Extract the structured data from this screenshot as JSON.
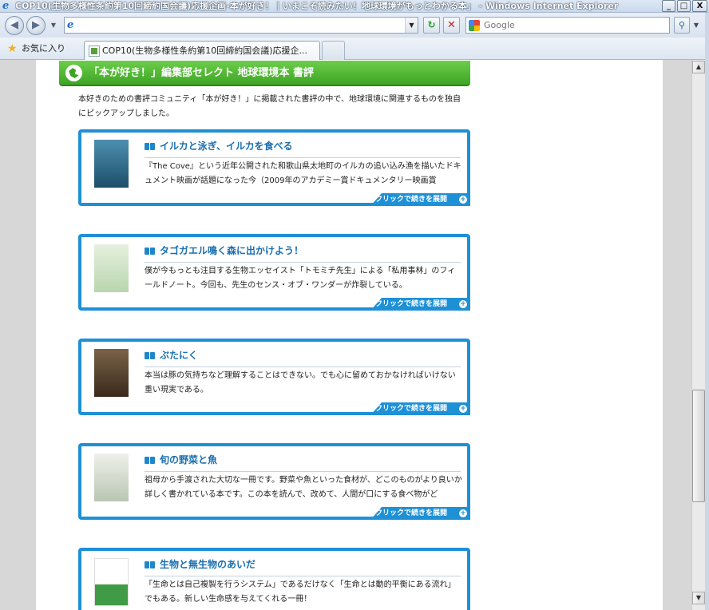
{
  "window": {
    "title": "COP10(生物多様性条約第10回締約国会議)応援企画-本が好き！｜いまこそ読みたい！地球環境がもっとわかる本」 - Windows Internet Explorer",
    "minimize": "_",
    "maximize": "□",
    "close": "X"
  },
  "navbar": {
    "address_value": "",
    "search_placeholder": "Google"
  },
  "favorites": {
    "label": "お気に入り",
    "tab_label": "COP10(生物多様性条約第10回締約国会議)応援企..."
  },
  "page": {
    "section_title": "「本が好き！」編集部セレクト 地球環境本 書評",
    "intro": "本好きのための書評コミュニティ「本が好き！」に掲載された書評の中で、地球環境に関連するものを独自にピックアップしました。",
    "expand_label": "クリックで続きを展開",
    "cards": [
      {
        "title": "イルカと泳ぎ、イルカを食べる",
        "text": "『The Cove』という近年公開された和歌山県太地町のイルカの追い込み漁を描いたドキュメント映画が話題になった今（2009年のアカデミー賞ドキュメンタリー映画賞",
        "thumb_color": "#2d6e8e"
      },
      {
        "title": "タゴガエル鳴く森に出かけよう！",
        "text": "僕が今もっとも注目する生物エッセイスト「トモミチ先生」による「私用事林」のフィールドノート。今回も、先生のセンス・オブ・ワンダーが炸裂している。",
        "thumb_color": "#cfe3c6"
      },
      {
        "title": "ぶたにく",
        "text": "本当は豚の気持ちなど理解することはできない。でも心に留めておかなければいけない重い現実である。",
        "thumb_color": "#5a4631"
      },
      {
        "title": "旬の野菜と魚",
        "text": "祖母から手渡された大切な一冊です。野菜や魚といった食材が、どこのものがより良いか詳しく書かれている本です。この本を読んで、改めて、人間が口にする食べ物がど",
        "thumb_color": "#d9dfd4"
      },
      {
        "title": "生物と無生物のあいだ",
        "text": "「生命とは自己複製を行うシステム」であるだけなく「生命とは動的平衡にある流れ」でもある。新しい生命感を与えてくれる一冊！",
        "thumb_color": "#ffffff"
      }
    ]
  }
}
